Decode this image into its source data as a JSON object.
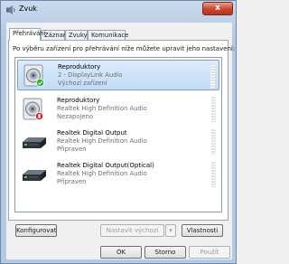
{
  "window": {
    "title": "Zvuk",
    "close_label": "x"
  },
  "tabs": [
    {
      "label": "Přehrávání"
    },
    {
      "label": "Záznam"
    },
    {
      "label": "Zvuky"
    },
    {
      "label": "Komunikace"
    }
  ],
  "instruction": "Po výběru zařízení pro přehrávání níže můžete upravit jeho nastavení:",
  "devices": [
    {
      "name": "Reproduktory",
      "description": "2 - DisplayLink Audio",
      "status": "Výchozí zařízení",
      "icon": "speaker-icon",
      "badge": "check-badge-icon",
      "badge_color": "#2fae2f"
    },
    {
      "name": "Reproduktory",
      "description": "Realtek High Definition Audio",
      "status": "Nezapojeno",
      "icon": "speaker-icon",
      "badge": "unplugged-badge-icon",
      "badge_color": "#d22a2a"
    },
    {
      "name": "Realtek Digital Output",
      "description": "Realtek High Definition Audio",
      "status": "Připraven",
      "icon": "digital-output-icon"
    },
    {
      "name": "Realtek Digital Output(Optical)",
      "description": "Realtek High Definition Audio",
      "status": "Připraven",
      "icon": "digital-output-icon"
    }
  ],
  "buttons": {
    "configure": "Konfigurovat",
    "set_default": "Nastavit výchozí",
    "properties": "Vlastnosti",
    "ok": "OK",
    "cancel": "Storno",
    "apply": "Použít"
  },
  "colors": {
    "selection": "#c1dcf7",
    "close_button": "#c9452c"
  }
}
